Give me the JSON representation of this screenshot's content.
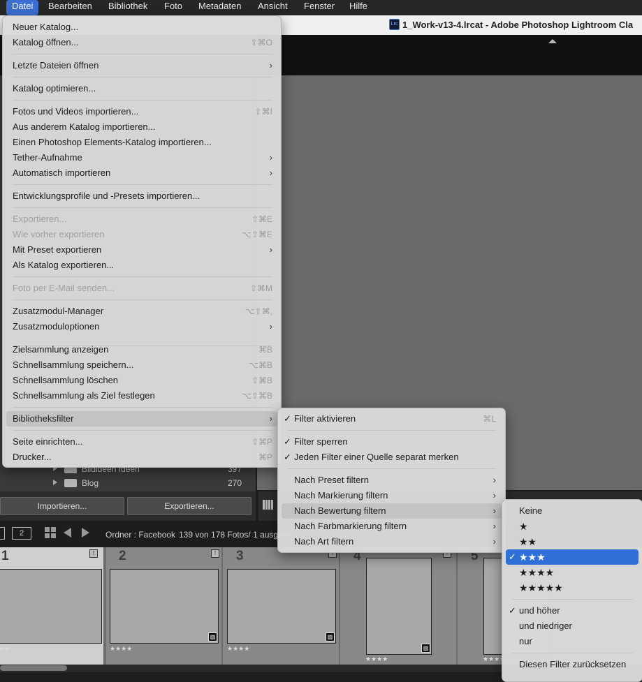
{
  "menubar": {
    "items": [
      "Datei",
      "Bearbeiten",
      "Bibliothek",
      "Foto",
      "Metadaten",
      "Ansicht",
      "Fenster",
      "Hilfe"
    ],
    "active": "Datei"
  },
  "window": {
    "app_icon": "Lrc",
    "title": "1_Work-v13-4.lrcat - Adobe Photoshop Lightroom Cla"
  },
  "left_panel": {
    "folders": [
      {
        "name": "Bildideen Ideen",
        "count": "397"
      },
      {
        "name": "Blog",
        "count": "270"
      }
    ],
    "import_label": "Importieren...",
    "export_label": "Exportieren..."
  },
  "filmstrip_bar": {
    "page_label": "2",
    "source": "Ordner : Facebook",
    "count": "139 von 178 Fotos/ 1 ausgew"
  },
  "filmstrip": {
    "cells": [
      {
        "num": "1",
        "stars": "★★",
        "selected": true
      },
      {
        "num": "2",
        "stars": "★★★★",
        "selected": false
      },
      {
        "num": "3",
        "stars": "★★★★",
        "selected": false
      },
      {
        "num": "4",
        "stars": "★★★★",
        "selected": false
      },
      {
        "num": "5",
        "stars": "★★★★",
        "selected": false
      }
    ],
    "flag_glyph": "!"
  },
  "datei_menu": {
    "items": [
      {
        "label": "Neuer Katalog...",
        "shortcut": "",
        "submenu": false,
        "disabled": false
      },
      {
        "label": "Katalog öffnen...",
        "shortcut": "⇧⌘O",
        "submenu": false,
        "disabled": false
      },
      {
        "label": "Letzte Dateien öffnen",
        "shortcut": "",
        "submenu": true,
        "disabled": false
      },
      {
        "label": "Katalog optimieren...",
        "shortcut": "",
        "submenu": false,
        "disabled": false
      },
      {
        "label": "Fotos und Videos importieren...",
        "shortcut": "⇧⌘I",
        "submenu": false,
        "disabled": false
      },
      {
        "label": "Aus anderem Katalog importieren...",
        "shortcut": "",
        "submenu": false,
        "disabled": false
      },
      {
        "label": "Einen Photoshop Elements-Katalog importieren...",
        "shortcut": "",
        "submenu": false,
        "disabled": false
      },
      {
        "label": "Tether-Aufnahme",
        "shortcut": "",
        "submenu": true,
        "disabled": false
      },
      {
        "label": "Automatisch importieren",
        "shortcut": "",
        "submenu": true,
        "disabled": false
      },
      {
        "label": "Entwicklungsprofile und -Presets importieren...",
        "shortcut": "",
        "submenu": false,
        "disabled": false
      },
      {
        "label": "Exportieren...",
        "shortcut": "⇧⌘E",
        "submenu": false,
        "disabled": true
      },
      {
        "label": "Wie vorher exportieren",
        "shortcut": "⌥⇧⌘E",
        "submenu": false,
        "disabled": true
      },
      {
        "label": "Mit Preset exportieren",
        "shortcut": "",
        "submenu": true,
        "disabled": false
      },
      {
        "label": "Als Katalog exportieren...",
        "shortcut": "",
        "submenu": false,
        "disabled": false
      },
      {
        "label": "Foto per E-Mail senden...",
        "shortcut": "⇧⌘M",
        "submenu": false,
        "disabled": true
      },
      {
        "label": "Zusatzmodul-Manager",
        "shortcut": "⌥⇧⌘,",
        "submenu": false,
        "disabled": false
      },
      {
        "label": "Zusatzmoduloptionen",
        "shortcut": "",
        "submenu": true,
        "disabled": false
      },
      {
        "label": "Zielsammlung anzeigen",
        "shortcut": "⌘B",
        "submenu": false,
        "disabled": false
      },
      {
        "label": "Schnellsammlung speichern...",
        "shortcut": "⌥⌘B",
        "submenu": false,
        "disabled": false
      },
      {
        "label": "Schnellsammlung löschen",
        "shortcut": "⇧⌘B",
        "submenu": false,
        "disabled": false
      },
      {
        "label": "Schnellsammlung als Ziel festlegen",
        "shortcut": "⌥⇧⌘B",
        "submenu": false,
        "disabled": false
      },
      {
        "label": "Bibliotheksfilter",
        "shortcut": "",
        "submenu": true,
        "disabled": false,
        "highlighted": true
      },
      {
        "label": "Seite einrichten...",
        "shortcut": "⇧⌘P",
        "submenu": false,
        "disabled": false
      },
      {
        "label": "Drucker...",
        "shortcut": "⌘P",
        "submenu": false,
        "disabled": false
      }
    ]
  },
  "filter_menu": {
    "items": [
      {
        "label": "Filter aktivieren",
        "shortcut": "⌘L",
        "checked": true,
        "submenu": false
      },
      {
        "label": "Filter sperren",
        "shortcut": "",
        "checked": true,
        "submenu": false
      },
      {
        "label": "Jeden Filter einer Quelle separat merken",
        "shortcut": "",
        "checked": true,
        "submenu": false
      },
      {
        "label": "Nach Preset filtern",
        "shortcut": "",
        "checked": false,
        "submenu": true
      },
      {
        "label": "Nach Markierung filtern",
        "shortcut": "",
        "checked": false,
        "submenu": true
      },
      {
        "label": "Nach Bewertung filtern",
        "shortcut": "",
        "checked": false,
        "submenu": true,
        "highlighted": true
      },
      {
        "label": "Nach Farbmarkierung filtern",
        "shortcut": "",
        "checked": false,
        "submenu": true
      },
      {
        "label": "Nach Art filtern",
        "shortcut": "",
        "checked": false,
        "submenu": true
      }
    ]
  },
  "rating_menu": {
    "items": [
      {
        "label": "Keine",
        "checked": false
      },
      {
        "label": "★",
        "checked": false
      },
      {
        "label": "★★",
        "checked": false
      },
      {
        "label": "★★★",
        "checked": true,
        "selected": true
      },
      {
        "label": "★★★★",
        "checked": false
      },
      {
        "label": "★★★★★",
        "checked": false
      },
      {
        "label": "und höher",
        "checked": true
      },
      {
        "label": "und niedriger",
        "checked": false
      },
      {
        "label": "nur",
        "checked": false
      },
      {
        "label": "Diesen Filter zurücksetzen",
        "checked": false
      }
    ]
  },
  "colors": {
    "accent": "#2f6fd6",
    "menu_bg": "#dadada",
    "menubar_bg": "#262626",
    "app_bg": "#6a6a6a"
  }
}
